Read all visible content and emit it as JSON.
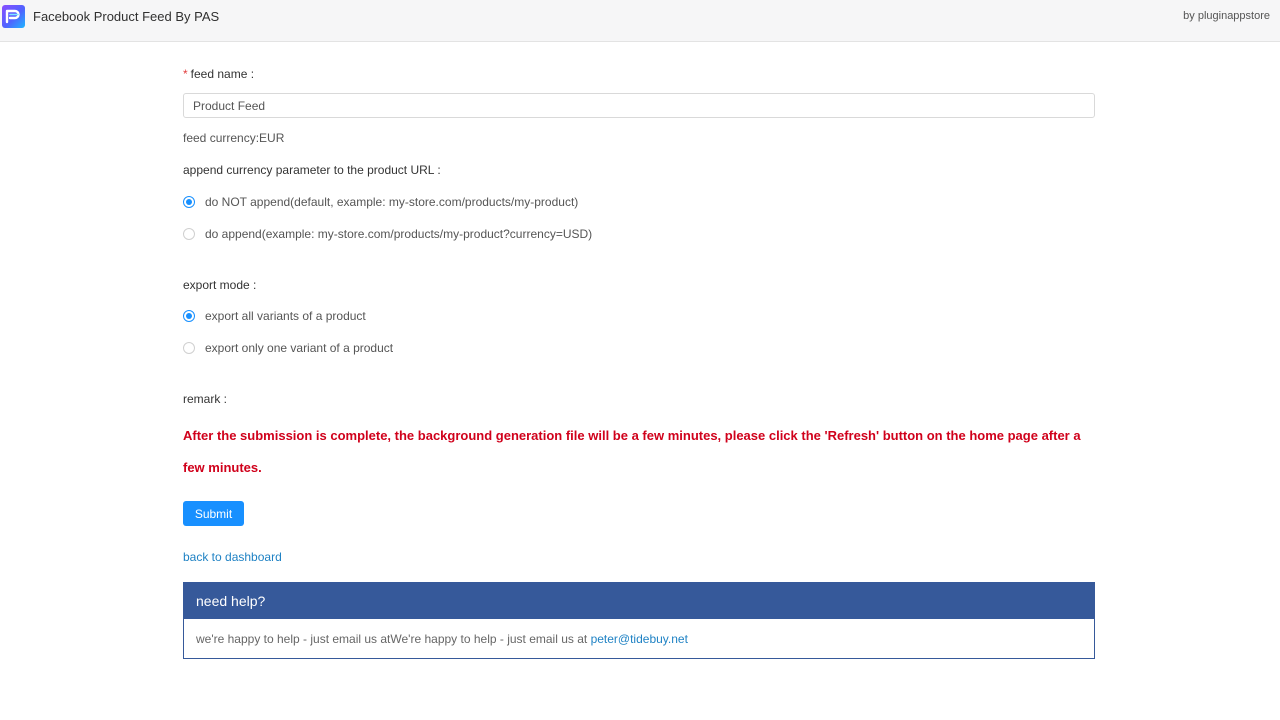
{
  "header": {
    "app_title": "Facebook Product Feed By PAS",
    "by_text": "by pluginappstore"
  },
  "form": {
    "feed_name": {
      "required_mark": "*",
      "label": "feed name :",
      "value": "Product Feed"
    },
    "feed_currency": "feed currency:EUR",
    "append_currency": {
      "label": "append currency parameter to the product URL :",
      "options": [
        {
          "label": "do NOT append(default, example: my-store.com/products/my-product)",
          "checked": true
        },
        {
          "label": "do append(example: my-store.com/products/my-product?currency=USD)",
          "checked": false
        }
      ]
    },
    "export_mode": {
      "label": "export mode :",
      "options": [
        {
          "label": "export all variants of a product",
          "checked": true
        },
        {
          "label": "export only one variant of a product",
          "checked": false
        }
      ]
    },
    "remark": {
      "label": "remark :",
      "text": "After the submission is complete, the background generation file will be a few minutes, please click the 'Refresh' button on the home page after a few minutes."
    },
    "submit_label": "Submit",
    "back_link": "back to dashboard"
  },
  "help": {
    "title": "need help?",
    "body": "we're happy to help - just email us atWe're happy to help - just email us at ",
    "email": "peter@tidebuy.net"
  },
  "colors": {
    "primary": "#1890ff",
    "help_header": "#36599a",
    "remark_red": "#d0011b",
    "link": "#1f82c4"
  }
}
